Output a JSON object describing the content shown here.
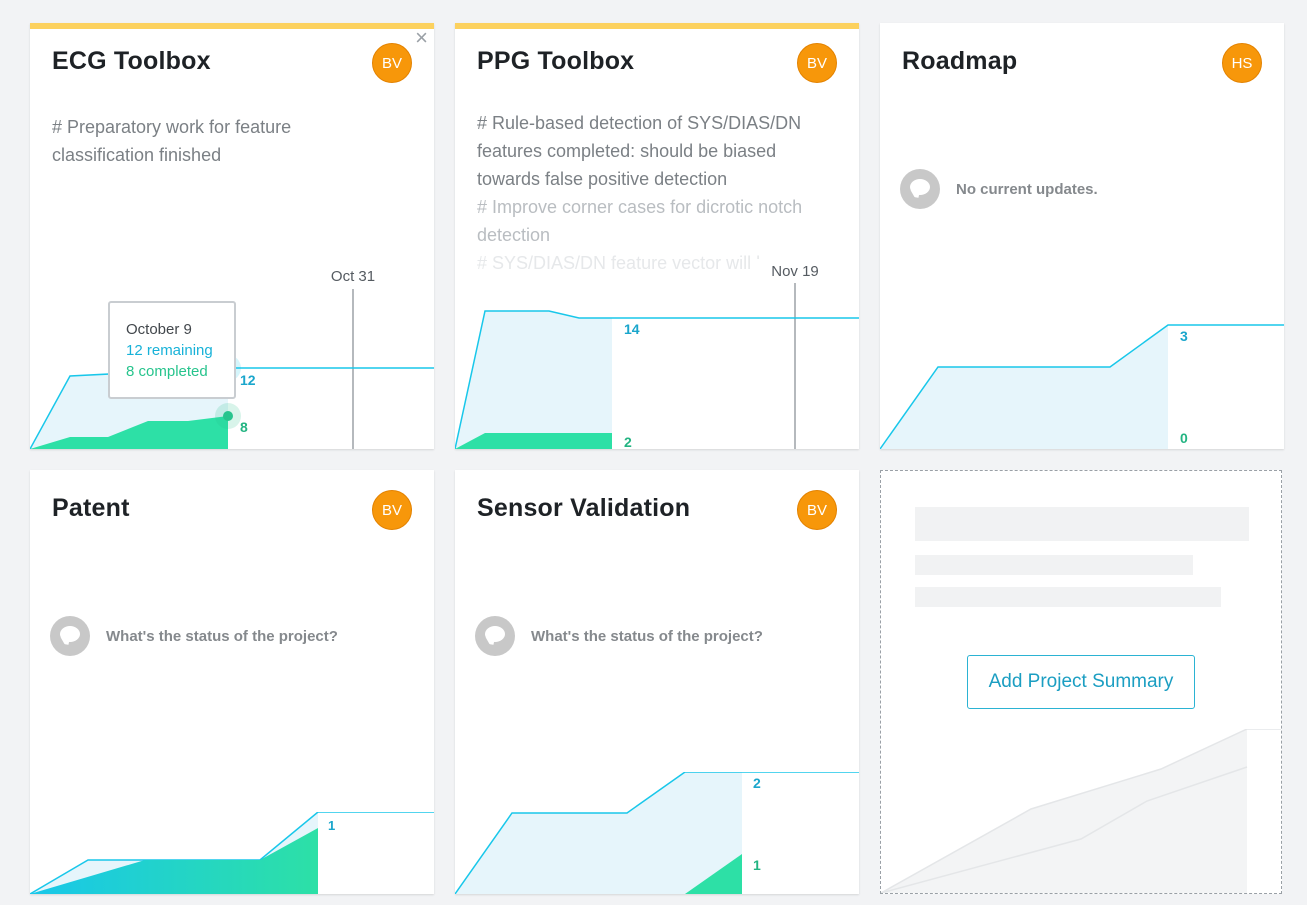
{
  "colors": {
    "remaining": "#18c7ea",
    "completed": "#2de0a6",
    "area_fill": "#e6f5fb",
    "highlight": "#fcd15e",
    "avatar": "#f7970a",
    "label": "#1aa6cc",
    "label_completed": "#23b482"
  },
  "cards": [
    {
      "title": "ECG Toolbox",
      "avatar": "BV",
      "close_icon": "close-icon",
      "summary_lines": [
        "# Preparatory work for feature",
        "classification finished"
      ],
      "marker_label": "Oct 31",
      "tooltip": {
        "date": "October 9",
        "remaining": "12 remaining",
        "completed": "8 completed"
      },
      "end_remaining": "12",
      "end_completed": "8"
    },
    {
      "title": "PPG Toolbox",
      "avatar": "BV",
      "summary_lines": [
        "# Rule-based detection of SYS/DIAS/DN",
        "features completed: should be biased",
        "towards false positive detection",
        "# Improve corner cases for dicrotic notch",
        "detection",
        "# SYS/DIAS/DN feature vector will be"
      ],
      "marker_label": "Nov 19",
      "end_remaining": "14",
      "end_completed": "2"
    },
    {
      "title": "Roadmap",
      "avatar": "HS",
      "status": "No current updates.",
      "end_remaining": "3",
      "end_completed": "0"
    },
    {
      "title": "Patent",
      "avatar": "BV",
      "status": "What's the status of the project?",
      "end_remaining": "1"
    },
    {
      "title": "Sensor Validation",
      "avatar": "BV",
      "status": "What's the status of the project?",
      "end_remaining": "2",
      "end_completed": "1"
    },
    {
      "add_button": "Add Project Summary"
    }
  ],
  "chart_data": [
    {
      "type": "area",
      "card": "ECG Toolbox",
      "series": [
        {
          "name": "remaining",
          "values": [
            0,
            12,
            12,
            12,
            12,
            12
          ]
        },
        {
          "name": "completed",
          "values": [
            0,
            2,
            2,
            5,
            5,
            8
          ]
        }
      ],
      "tooltip_point": {
        "date": "October 9",
        "remaining": 12,
        "completed": 8
      }
    },
    {
      "type": "area",
      "card": "PPG Toolbox",
      "series": [
        {
          "name": "remaining",
          "values": [
            0,
            20,
            20,
            19,
            19,
            19
          ]
        },
        {
          "name": "completed",
          "values": [
            0,
            2,
            2,
            2,
            2,
            2
          ]
        }
      ]
    },
    {
      "type": "area",
      "card": "Roadmap",
      "series": [
        {
          "name": "remaining",
          "values": [
            0,
            2,
            2,
            2,
            3,
            3
          ]
        },
        {
          "name": "completed",
          "values": [
            0,
            0,
            0,
            0,
            0,
            0
          ]
        }
      ]
    },
    {
      "type": "area",
      "card": "Patent",
      "series": [
        {
          "name": "remaining",
          "values": [
            0,
            0.4,
            0.4,
            0.4,
            1,
            1
          ]
        },
        {
          "name": "completed",
          "values": [
            0,
            0.2,
            0.4,
            0.4,
            0.8,
            1
          ]
        }
      ]
    },
    {
      "type": "area",
      "card": "Sensor Validation",
      "series": [
        {
          "name": "remaining",
          "values": [
            0,
            1,
            1,
            1.5,
            2,
            2
          ]
        },
        {
          "name": "completed",
          "values": [
            0,
            0,
            0,
            0,
            0,
            1
          ]
        }
      ]
    }
  ]
}
